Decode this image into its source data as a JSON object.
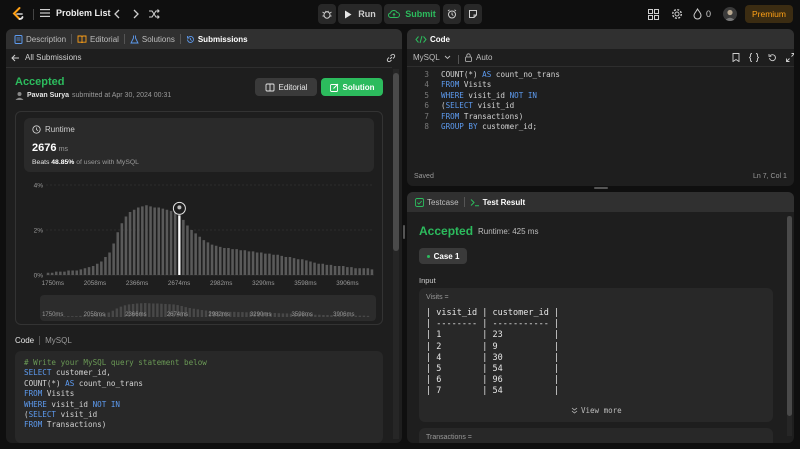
{
  "topbar": {
    "problem_list": "Problem List",
    "run_label": "Run",
    "submit_label": "Submit",
    "streak_count": "0",
    "premium_label": "Premium"
  },
  "left_tabs": {
    "description": "Description",
    "editorial": "Editorial",
    "solutions": "Solutions",
    "submissions": "Submissions"
  },
  "submission": {
    "back_label": "All Submissions",
    "status": "Accepted",
    "user": "Pavan Surya",
    "submitted_text": "submitted at Apr 30, 2024 00:31",
    "editorial_button": "Editorial",
    "solution_button": "Solution",
    "runtime_title": "Runtime",
    "runtime_value": "2676",
    "runtime_unit": "ms",
    "beats_prefix": "Beats",
    "beats_value": "48.85%",
    "beats_suffix": "of users with MySQL"
  },
  "chart_data": {
    "type": "bar",
    "ylabels": [
      "4%",
      "2%",
      "0%"
    ],
    "yticks": [
      4,
      2,
      0
    ],
    "ylim": [
      0,
      4
    ],
    "xlabels": [
      "1750ms",
      "2058ms",
      "2366ms",
      "2674ms",
      "2982ms",
      "3290ms",
      "3598ms",
      "3906ms"
    ],
    "xticks": [
      1750,
      2058,
      2366,
      2674,
      2982,
      3290,
      3598,
      3906
    ],
    "xlim": [
      1700,
      4100
    ],
    "bin_start": 1700,
    "bin_width": 30,
    "values": [
      0.1,
      0.1,
      0.15,
      0.15,
      0.15,
      0.2,
      0.2,
      0.2,
      0.25,
      0.3,
      0.35,
      0.4,
      0.5,
      0.6,
      0.8,
      1.0,
      1.4,
      1.9,
      2.3,
      2.6,
      2.8,
      2.9,
      3.0,
      3.05,
      3.1,
      3.05,
      3.0,
      3.0,
      2.95,
      2.9,
      2.85,
      2.8,
      2.65,
      2.45,
      2.2,
      2.0,
      1.85,
      1.7,
      1.55,
      1.45,
      1.35,
      1.3,
      1.25,
      1.2,
      1.2,
      1.15,
      1.15,
      1.1,
      1.1,
      1.05,
      1.05,
      1.0,
      1.0,
      0.95,
      0.95,
      0.9,
      0.9,
      0.85,
      0.8,
      0.8,
      0.75,
      0.7,
      0.7,
      0.65,
      0.6,
      0.55,
      0.5,
      0.5,
      0.45,
      0.45,
      0.4,
      0.4,
      0.4,
      0.35,
      0.35,
      0.3,
      0.3,
      0.3,
      0.3,
      0.25
    ],
    "highlight_value": 2676
  },
  "code_section": {
    "code_label": "Code",
    "lang_label": "MySQL",
    "lines": [
      [
        [
          "cm",
          "# Write your MySQL query statement below"
        ]
      ],
      [
        [
          "kw",
          "SELECT"
        ],
        [
          "tx",
          " customer_id,"
        ]
      ],
      [
        [
          "tx",
          "COUNT(*) "
        ],
        [
          "kw",
          "AS"
        ],
        [
          "tx",
          " count_no_trans"
        ]
      ],
      [
        [
          "kw",
          "FROM"
        ],
        [
          "tx",
          " Visits"
        ]
      ],
      [
        [
          "kw",
          "WHERE"
        ],
        [
          "tx",
          " visit_id "
        ],
        [
          "kw",
          "NOT IN"
        ]
      ],
      [
        [
          "tx",
          "("
        ],
        [
          "kw",
          "SELECT"
        ],
        [
          "tx",
          " visit_id"
        ]
      ],
      [
        [
          "kw",
          "FROM"
        ],
        [
          "tx",
          " Transactions)"
        ]
      ]
    ]
  },
  "editor": {
    "title": "Code",
    "language": "MySQL",
    "auto_label": "Auto",
    "saved_label": "Saved",
    "cursor_pos": "Ln 7, Col 1",
    "lines": [
      {
        "n": "3",
        "tokens": [
          [
            "tx",
            "COUNT(*) "
          ],
          [
            "kw",
            "AS"
          ],
          [
            "tx",
            " count_no_trans"
          ]
        ]
      },
      {
        "n": "4",
        "tokens": [
          [
            "kw",
            "FROM"
          ],
          [
            "tx",
            " Visits"
          ]
        ]
      },
      {
        "n": "5",
        "tokens": [
          [
            "kw",
            "WHERE"
          ],
          [
            "tx",
            " visit_id "
          ],
          [
            "kw",
            "NOT IN"
          ]
        ]
      },
      {
        "n": "6",
        "tokens": [
          [
            "tx",
            "("
          ],
          [
            "kw",
            "SELECT"
          ],
          [
            "tx",
            " visit_id"
          ]
        ]
      },
      {
        "n": "7",
        "tokens": [
          [
            "kw",
            "FROM"
          ],
          [
            "tx",
            " Transactions)"
          ]
        ]
      },
      {
        "n": "8",
        "tokens": [
          [
            "kw",
            "GROUP BY"
          ],
          [
            "tx",
            " customer_id;"
          ]
        ]
      }
    ]
  },
  "result": {
    "testcase_tab": "Testcase",
    "result_tab": "Test Result",
    "status": "Accepted",
    "runtime": "Runtime: 425 ms",
    "case_label": "Case 1",
    "input_label": "Input",
    "visits_label": "Visits =",
    "table_lines": [
      "| visit_id | customer_id |",
      "| -------- | ----------- |",
      "| 1        | 23          |",
      "| 2        | 9           |",
      "| 4        | 30          |",
      "| 5        | 54          |",
      "| 6        | 96          |",
      "| 7        | 54          |"
    ],
    "view_more": "View more",
    "transactions_label": "Transactions ="
  },
  "colors": {
    "accent_green": "#2cbb5d",
    "premium": "#ffa116",
    "keyword": "#5d9bf0",
    "comment": "#6a9955"
  }
}
